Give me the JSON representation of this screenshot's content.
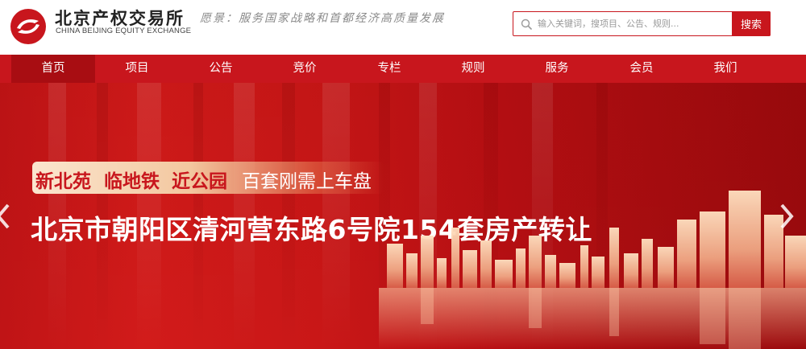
{
  "brand": {
    "name_cn": "北京产权交易所",
    "name_en": "CHINA BEIJING EQUITY EXCHANGE",
    "vision": "愿景：服务国家战略和首都经济高质量发展"
  },
  "search": {
    "placeholder": "输入关键词，搜项目、公告、规则...",
    "button_label": "搜索"
  },
  "nav": {
    "items": [
      {
        "label": "首页",
        "active": true
      },
      {
        "label": "项目"
      },
      {
        "label": "公告"
      },
      {
        "label": "竞价"
      },
      {
        "label": "专栏"
      },
      {
        "label": "规则"
      },
      {
        "label": "服务"
      },
      {
        "label": "会员"
      },
      {
        "label": "我们"
      }
    ]
  },
  "banner": {
    "tag_1": "新北苑",
    "tag_2": "临地铁",
    "tag_3": "近公园",
    "tag_4": "百套刚需上车盘",
    "title": "北京市朝阳区清河营东路6号院154套房产转让"
  },
  "colors": {
    "brand_red": "#c8161d",
    "nav_active": "#a80d12",
    "gold": "#f3c79f"
  },
  "icons": {
    "logo": "bjex-logo-icon",
    "search": "search-icon",
    "prev": "chevron-left-icon",
    "next": "chevron-right-icon"
  }
}
